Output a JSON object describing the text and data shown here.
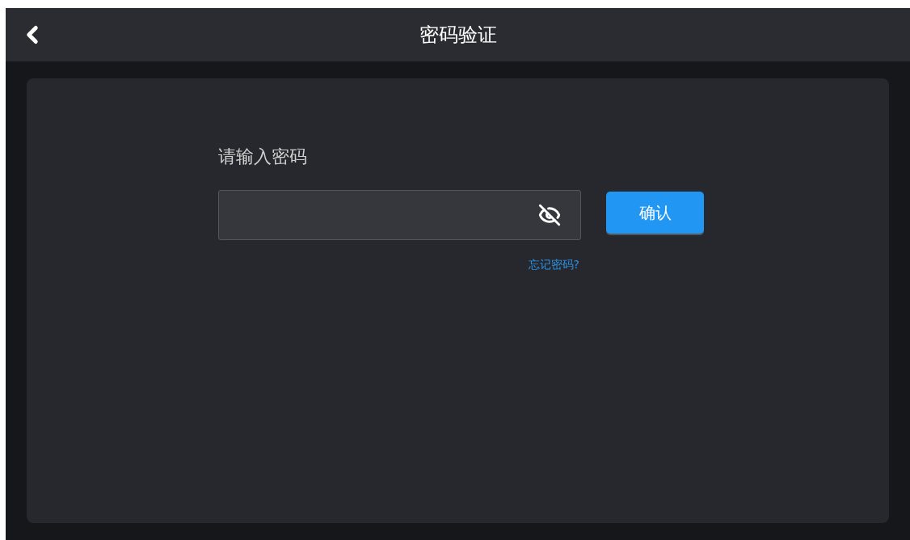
{
  "header": {
    "title": "密码验证"
  },
  "form": {
    "label": "请输入密码",
    "password_visible": false,
    "confirm_button": "确认",
    "forgot_link": "忘记密码?"
  }
}
